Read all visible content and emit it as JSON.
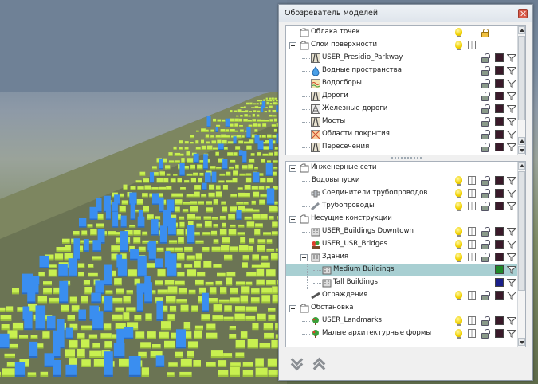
{
  "window": {
    "title": "Обозреватель моделей"
  },
  "top_tree": [
    {
      "label": "Облака точек",
      "level": 0,
      "expander": false,
      "icon": "folder-icon",
      "bulb": true,
      "book": false,
      "lock": "gold",
      "swatch": null,
      "filter": false
    },
    {
      "label": "Слои поверхности",
      "level": 0,
      "expander": true,
      "icon": "folder-icon",
      "bulb": true,
      "book": true,
      "lock": null,
      "swatch": null,
      "filter": false
    },
    {
      "label": "USER_Presidio_Parkway",
      "level": 1,
      "expander": false,
      "icon": "road-layer-icon",
      "bulb": false,
      "book": false,
      "lock": "open",
      "swatch": "#3a1a2a",
      "filter": true
    },
    {
      "label": "Водные пространства",
      "level": 1,
      "expander": false,
      "icon": "water-drop-icon",
      "bulb": false,
      "book": false,
      "lock": "open",
      "swatch": "#3a1a2a",
      "filter": true
    },
    {
      "label": "Водосборы",
      "level": 1,
      "expander": false,
      "icon": "catchment-icon",
      "bulb": false,
      "book": false,
      "lock": "open",
      "swatch": "#3a1a2a",
      "filter": true
    },
    {
      "label": "Дороги",
      "level": 1,
      "expander": false,
      "icon": "road-layer-icon",
      "bulb": false,
      "book": false,
      "lock": "open",
      "swatch": "#3a1a2a",
      "filter": true
    },
    {
      "label": "Железные дороги",
      "level": 1,
      "expander": false,
      "icon": "rail-layer-icon",
      "bulb": false,
      "book": false,
      "lock": "open",
      "swatch": "#3a1a2a",
      "filter": true
    },
    {
      "label": "Мосты",
      "level": 1,
      "expander": false,
      "icon": "road-layer-icon",
      "bulb": false,
      "book": false,
      "lock": "open",
      "swatch": "#3a1a2a",
      "filter": true
    },
    {
      "label": "Области покрытия",
      "level": 1,
      "expander": false,
      "icon": "coverage-icon",
      "bulb": false,
      "book": false,
      "lock": "open",
      "swatch": "#3a1a2a",
      "filter": true
    },
    {
      "label": "Пересечения",
      "level": 1,
      "expander": false,
      "icon": "road-layer-icon",
      "bulb": false,
      "book": false,
      "lock": "open",
      "swatch": "#3a1a2a",
      "filter": true
    }
  ],
  "bottom_tree": [
    {
      "label": "Инженерные сети",
      "level": 0,
      "expander": true,
      "icon": "folder-icon",
      "bulb": false,
      "book": false,
      "lock": null,
      "swatch": null,
      "filter": false,
      "selected": false
    },
    {
      "label": "Водовыпуски",
      "level": 1,
      "expander": false,
      "icon": "",
      "bulb": true,
      "book": true,
      "lock": "open",
      "swatch": "#3a1a2a",
      "filter": true,
      "selected": false
    },
    {
      "label": "Соединители трубопроводов",
      "level": 1,
      "expander": false,
      "icon": "pipe-connector-icon",
      "bulb": true,
      "book": true,
      "lock": "open",
      "swatch": "#3a1a2a",
      "filter": true,
      "selected": false
    },
    {
      "label": "Трубопроводы",
      "level": 1,
      "expander": false,
      "icon": "pipe-icon",
      "bulb": true,
      "book": true,
      "lock": "open",
      "swatch": "#3a1a2a",
      "filter": true,
      "selected": false
    },
    {
      "label": "Несущие конструкции",
      "level": 0,
      "expander": true,
      "icon": "folder-icon",
      "bulb": false,
      "book": false,
      "lock": null,
      "swatch": null,
      "filter": false,
      "selected": false
    },
    {
      "label": "USER_Buildings Downtown",
      "level": 1,
      "expander": false,
      "icon": "building-icon",
      "bulb": true,
      "book": true,
      "lock": "open",
      "swatch": "#3a1a2a",
      "filter": true,
      "selected": false
    },
    {
      "label": "USER_USR_Bridges",
      "level": 1,
      "expander": false,
      "icon": "bridge-icon",
      "bulb": true,
      "book": true,
      "lock": "open",
      "swatch": "#3a1a2a",
      "filter": true,
      "selected": false
    },
    {
      "label": "Здания",
      "level": 1,
      "expander": true,
      "icon": "building-icon",
      "bulb": true,
      "book": true,
      "lock": "open",
      "swatch": "#3a1a2a",
      "filter": true,
      "selected": false
    },
    {
      "label": "Medium Buildings",
      "level": 2,
      "expander": false,
      "icon": "building-icon",
      "bulb": false,
      "book": false,
      "lock": null,
      "swatch": "#1f8a2a",
      "filter": true,
      "selected": true
    },
    {
      "label": "Tall Buildings",
      "level": 2,
      "expander": false,
      "icon": "building-icon",
      "bulb": false,
      "book": false,
      "lock": null,
      "swatch": "#1a1f8a",
      "filter": true,
      "selected": false
    },
    {
      "label": "Ограждения",
      "level": 1,
      "expander": false,
      "icon": "fence-icon",
      "bulb": true,
      "book": true,
      "lock": "open",
      "swatch": "#3a1a2a",
      "filter": true,
      "selected": false
    },
    {
      "label": "Обстановка",
      "level": 0,
      "expander": true,
      "icon": "folder-icon",
      "bulb": false,
      "book": false,
      "lock": null,
      "swatch": null,
      "filter": false,
      "selected": false
    },
    {
      "label": "USER_Landmarks",
      "level": 1,
      "expander": false,
      "icon": "tree-icon",
      "bulb": true,
      "book": true,
      "lock": "open",
      "swatch": "#3a1a2a",
      "filter": true,
      "selected": false
    },
    {
      "label": "Малые архитектурные формы",
      "level": 1,
      "expander": false,
      "icon": "tree-icon",
      "bulb": true,
      "book": true,
      "lock": "open",
      "swatch": "#3a1a2a",
      "filter": true,
      "selected": false
    }
  ],
  "colors": {
    "sky": "#6f8196",
    "buildings_medium": "#c8f050",
    "buildings_tall": "#3a8ef0",
    "selection": "#a8cfd2"
  }
}
